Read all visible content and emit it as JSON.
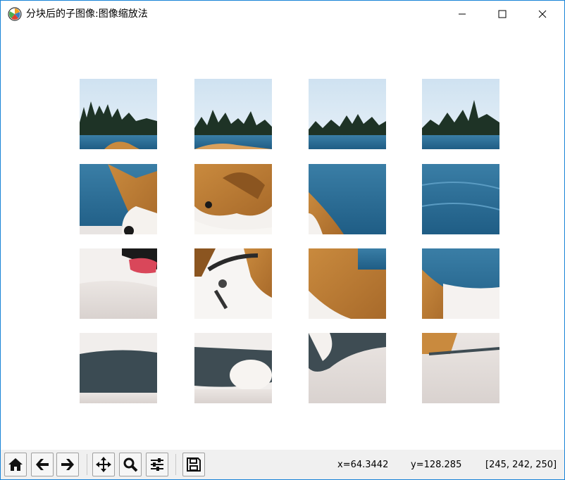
{
  "window": {
    "title": "分块后的子图像:图像缩放法"
  },
  "controls": {
    "minimize": "minimize",
    "maximize": "maximize",
    "close": "close"
  },
  "toolbar": {
    "buttons": [
      "home-icon",
      "back-arrow-icon",
      "forward-arrow-icon",
      "pan-icon",
      "zoom-icon",
      "configure-subplots-icon",
      "save-icon"
    ]
  },
  "status": {
    "x_readout": "x=64.3442",
    "y_readout": "y=128.285",
    "pixel_value": "[245, 242, 250]"
  },
  "grid": {
    "rows": 4,
    "cols": 4
  }
}
